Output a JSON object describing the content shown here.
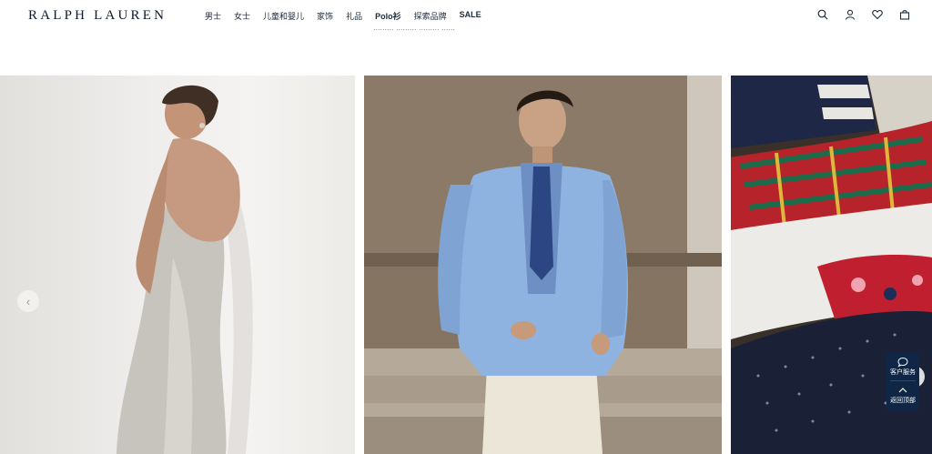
{
  "brand": {
    "logo_text": "RALPH LAUREN"
  },
  "nav": {
    "items": [
      {
        "label": "男士"
      },
      {
        "label": "女士"
      },
      {
        "label": "儿童和婴儿"
      },
      {
        "label": "家饰"
      },
      {
        "label": "礼品"
      },
      {
        "label": "Polo衫"
      },
      {
        "label": "探索品牌"
      },
      {
        "label": "SALE"
      }
    ]
  },
  "header_icons": [
    "search-icon",
    "account-icon",
    "wishlist-heart-icon",
    "shopping-bag-icon"
  ],
  "carousel": {
    "panels": [
      {
        "subject": "woman-in-satin-gown"
      },
      {
        "subject": "man-in-blue-blazer"
      },
      {
        "subject": "patterned-pillows"
      }
    ],
    "prev_arrow": "‹",
    "next_arrow": "›"
  },
  "service_widget": {
    "chat_label": "客户服务",
    "top_label": "返回顶部"
  },
  "colors": {
    "navy": "#0f2646",
    "text": "#0b1a2e"
  }
}
